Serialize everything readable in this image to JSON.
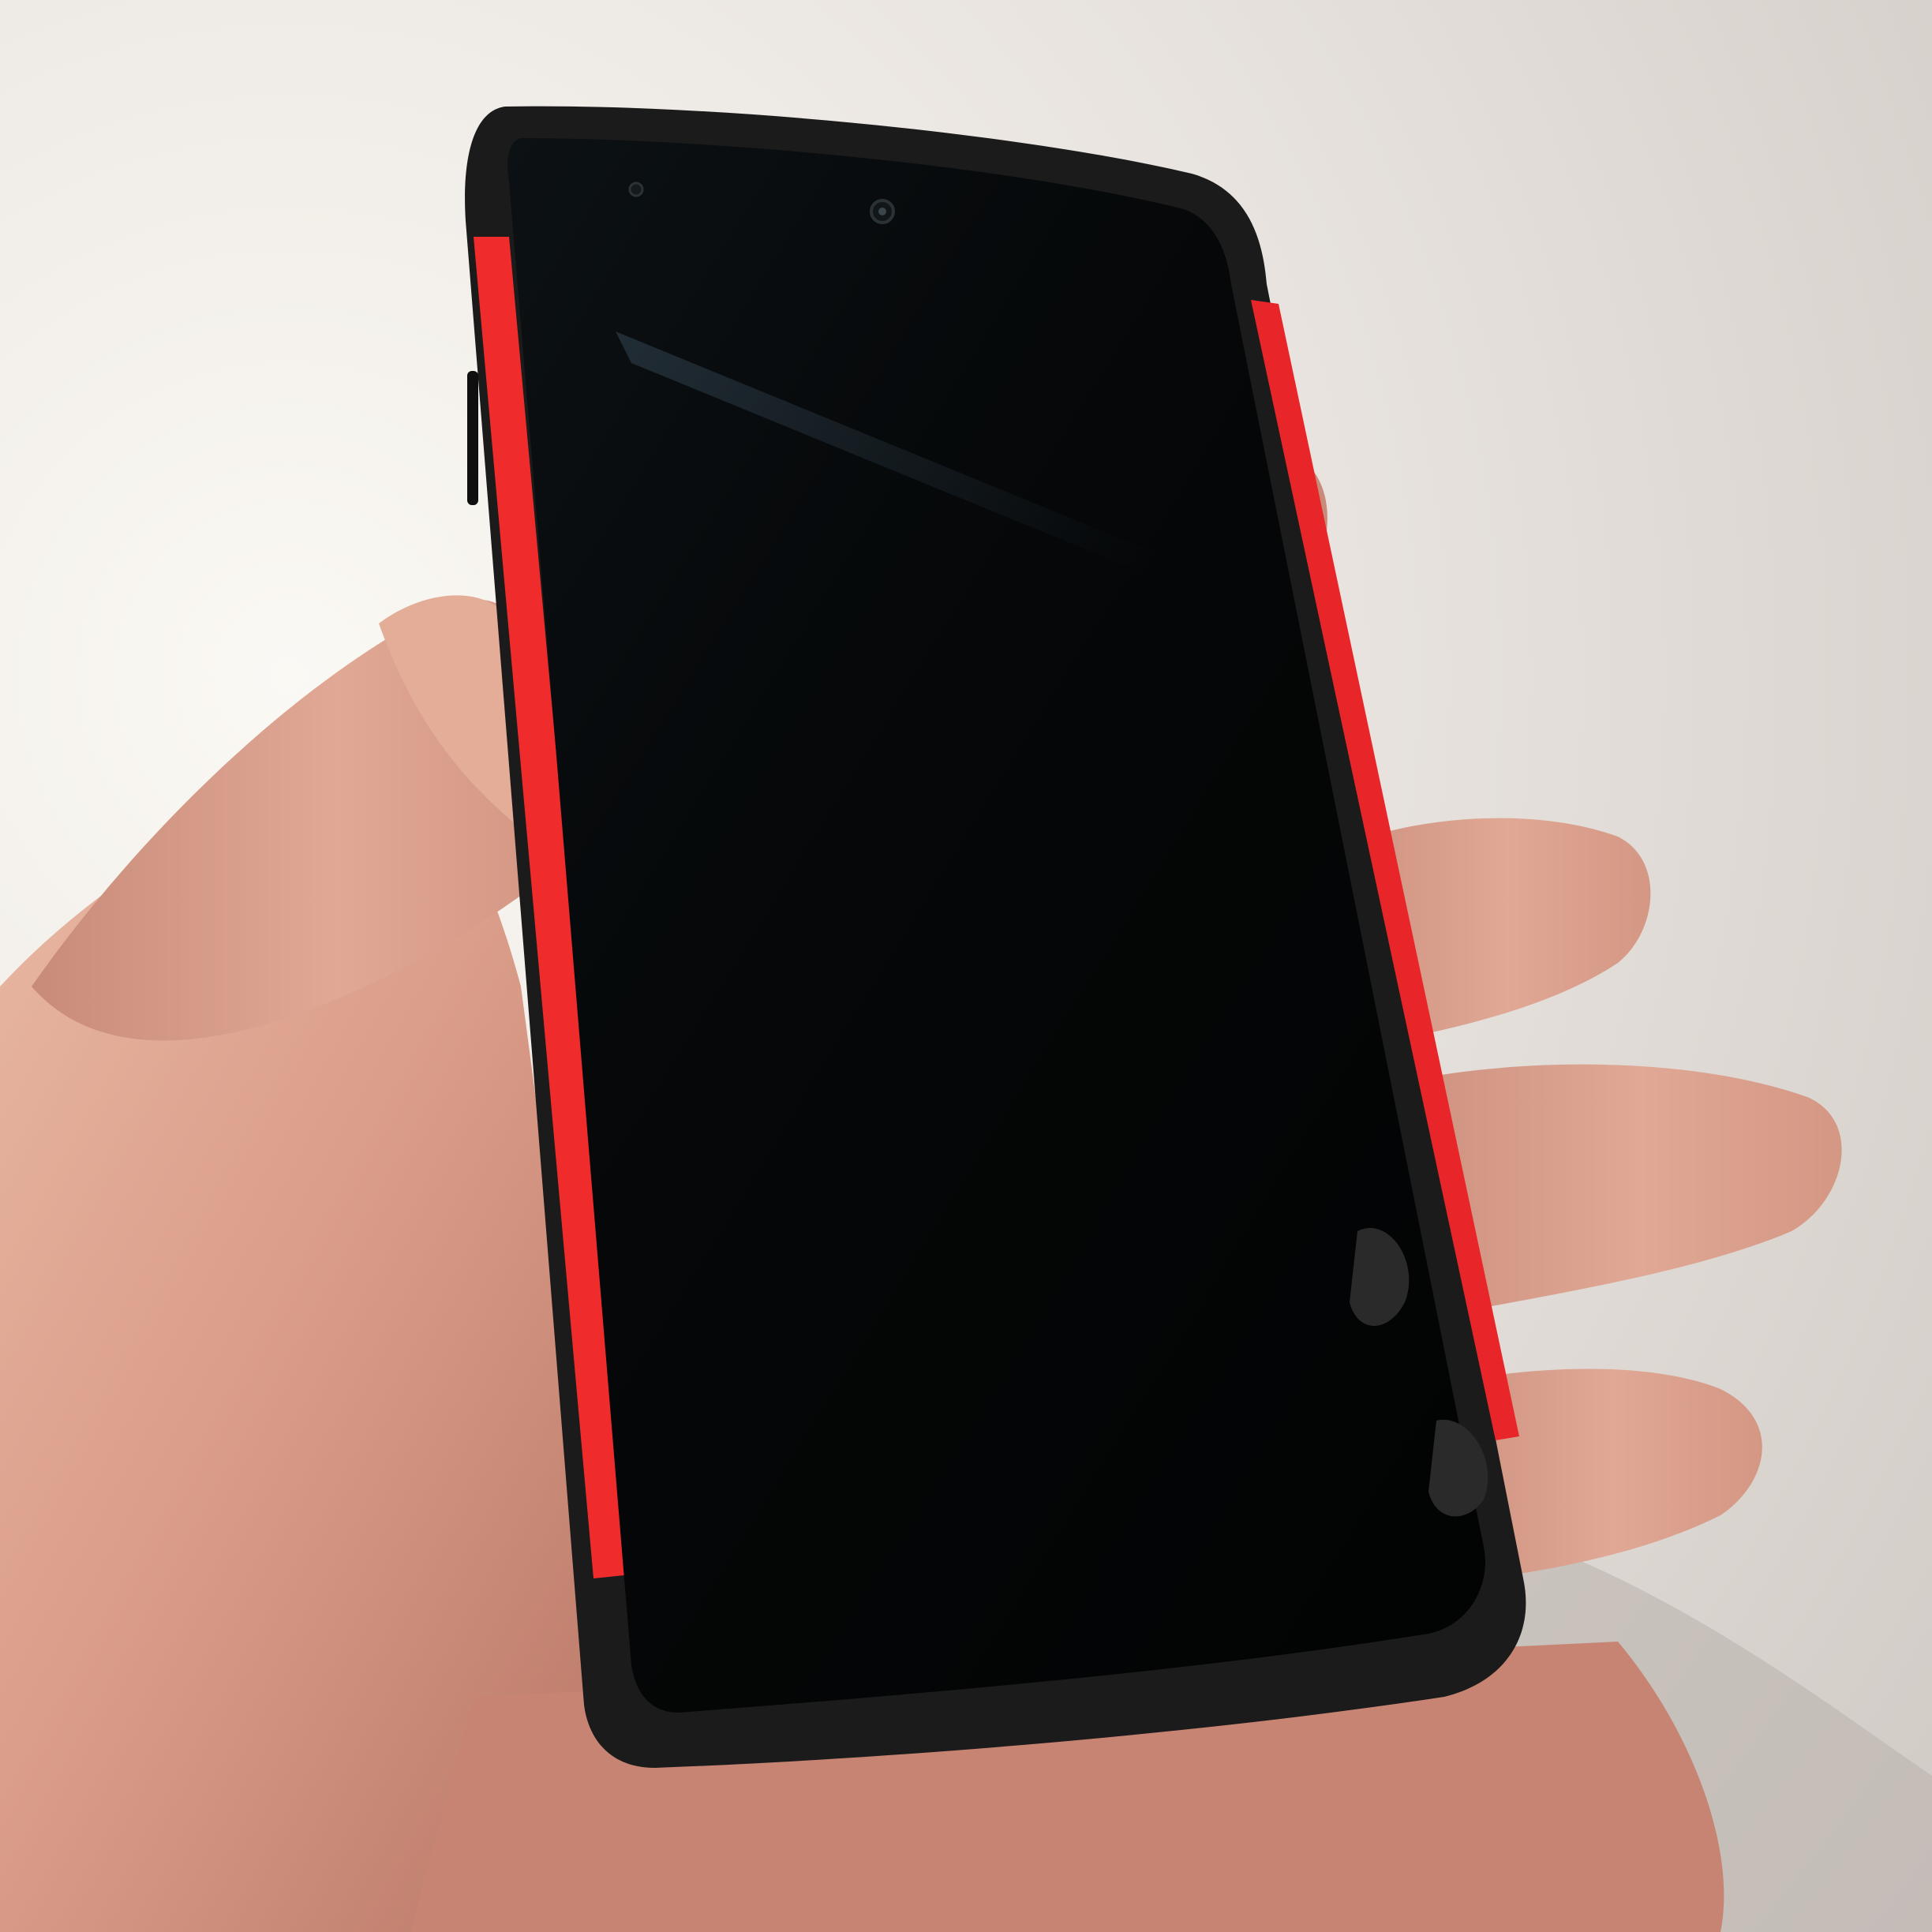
{
  "scene": {
    "subject": "hand-holding-smartphone",
    "screen_state": "off"
  },
  "colors": {
    "background": "#ece8e4",
    "case_black": "#1b1b1b",
    "case_accent": "#ef2b2b",
    "screen": "#050708",
    "skin": "#d8a08c",
    "skin_shadow": "#b47868"
  },
  "icons": {
    "front_camera": "camera-lens-icon",
    "proximity_sensor": "sensor-dot-icon"
  }
}
